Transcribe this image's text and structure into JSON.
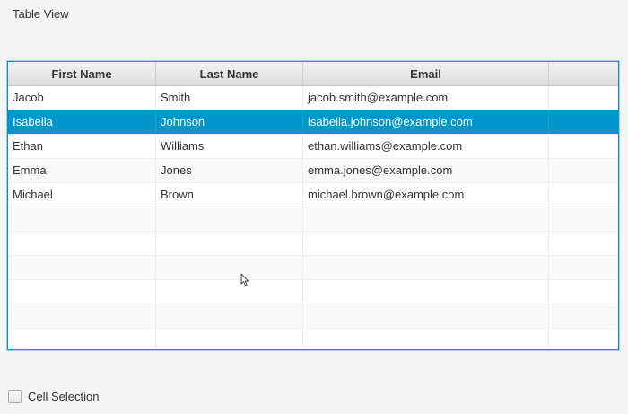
{
  "app": {
    "title": "Table View"
  },
  "table": {
    "columns": [
      "First Name",
      "Last Name",
      "Email",
      ""
    ],
    "selected_row": 1,
    "rows": [
      {
        "first": "Jacob",
        "last": "Smith",
        "email": "jacob.smith@example.com"
      },
      {
        "first": "Isabella",
        "last": "Johnson",
        "email": "isabella.johnson@example.com"
      },
      {
        "first": "Ethan",
        "last": "Williams",
        "email": "ethan.williams@example.com"
      },
      {
        "first": "Emma",
        "last": "Jones",
        "email": "emma.jones@example.com"
      },
      {
        "first": "Michael",
        "last": "Brown",
        "email": "michael.brown@example.com"
      }
    ]
  },
  "cell_selection": {
    "label": "Cell Selection",
    "checked": false
  },
  "colors": {
    "accent": "#0096c9",
    "selected_text": "#ffffff"
  },
  "cursor": {
    "icon": "arrow-cursor-icon"
  }
}
